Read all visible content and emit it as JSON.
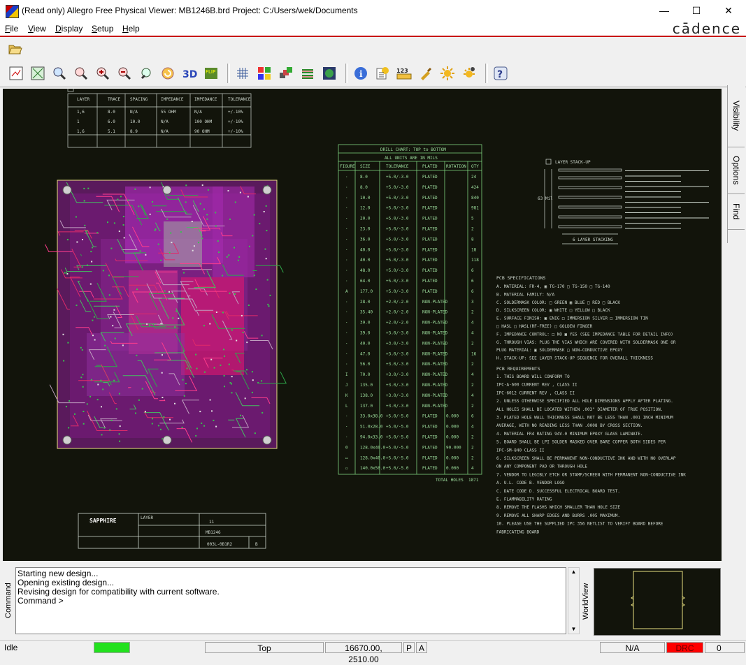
{
  "window": {
    "title": "(Read only) Allegro Free Physical Viewer: MB1246B.brd  Project: C:/Users/wek/Documents",
    "minimize": "—",
    "maximize": "☐",
    "close": "✕"
  },
  "brand": "cādence",
  "menu": [
    {
      "label": "File",
      "key": "F",
      "rest": "ile"
    },
    {
      "label": "View",
      "key": "V",
      "rest": "iew"
    },
    {
      "label": "Display",
      "key": "D",
      "rest": "isplay"
    },
    {
      "label": "Setup",
      "key": "S",
      "rest": "etup"
    },
    {
      "label": "Help",
      "key": "H",
      "rest": "elp"
    }
  ],
  "toolbar_icons": [
    "open-icon",
    "zoom-fit-icon",
    "zoom-world-icon",
    "zoom-window-icon",
    "zoom-previous-icon",
    "zoom-in-icon",
    "zoom-out-icon",
    "redraw-icon",
    "refresh-icon",
    "3d-view-icon",
    "flip-icon",
    "grid-icon",
    "color-icon",
    "layers-icon",
    "stack-icon",
    "world-icon",
    "info-icon",
    "properties-icon",
    "measure-icon",
    "highlight-icon",
    "brightness-icon",
    "dim-icon",
    "help-icon"
  ],
  "right_tabs": [
    "Visibility",
    "Options",
    "Find"
  ],
  "command": {
    "label": "Command",
    "lines": [
      "Starting new design...",
      "Opening existing design...",
      "Revising design for compatibility with current software.",
      "Command >"
    ]
  },
  "worldview_label": "WorldView",
  "status": {
    "state": "Idle",
    "layer": "Top",
    "coords": "16670.00, 2510.00",
    "p_btn": "P",
    "a_btn": "A",
    "na": "N/A",
    "drc": "DRC",
    "count": "0"
  },
  "colors": {
    "accent_red": "#c81414",
    "canvas_bg": "#12140b",
    "drawing_green": "#7fd47f",
    "board_purple": "#6b1a6f",
    "status_green": "#22e11e",
    "drc_red": "#ff0000"
  },
  "drawing": {
    "drill_chart_title": "DRILL CHART: TOP to BOTTOM",
    "drill_chart_units": "ALL UNITS ARE IN MILS",
    "drill_headers": [
      "FIGURE",
      "SIZE",
      "TOLERANCE",
      "PLATED",
      "ROTATION",
      "QTY"
    ],
    "drill_rows": [
      [
        "·",
        "8.0",
        "+5.0/-3.0",
        "PLATED",
        "",
        "24"
      ],
      [
        "·",
        "8.0",
        "+5.0/-3.0",
        "PLATED",
        "",
        "424"
      ],
      [
        "·",
        "10.0",
        "+5.0/-3.0",
        "PLATED",
        "",
        "840"
      ],
      [
        "·",
        "12.0",
        "+5.0/-3.0",
        "PLATED",
        "",
        "981"
      ],
      [
        "·",
        "20.0",
        "+5.0/-3.0",
        "PLATED",
        "",
        "5"
      ],
      [
        "·",
        "23.0",
        "+5.0/-3.0",
        "PLATED",
        "",
        "2"
      ],
      [
        "·",
        "36.0",
        "+5.0/-3.0",
        "PLATED",
        "",
        "8"
      ],
      [
        "·",
        "40.0",
        "+5.0/-3.0",
        "PLATED",
        "",
        "18"
      ],
      [
        "·",
        "40.0",
        "+5.0/-3.0",
        "PLATED",
        "",
        "118"
      ],
      [
        "·",
        "48.0",
        "+5.0/-3.0",
        "PLATED",
        "",
        "6"
      ],
      [
        "·",
        "64.0",
        "+5.0/-3.0",
        "PLATED",
        "",
        "6"
      ],
      [
        "A",
        "177.0",
        "+5.0/-3.0",
        "PLATED",
        "",
        "6"
      ],
      [
        "·",
        "28.0",
        "+2.0/-2.0",
        "NON-PLATED",
        "",
        "3"
      ],
      [
        "·",
        "35.40",
        "+2.0/-2.0",
        "NON-PLATED",
        "",
        "2"
      ],
      [
        "·",
        "39.0",
        "+2.0/-2.0",
        "NON-PLATED",
        "",
        "4"
      ],
      [
        "·",
        "39.0",
        "+3.0/-3.0",
        "NON-PLATED",
        "",
        "4"
      ],
      [
        "·",
        "40.0",
        "+3.0/-3.0",
        "NON-PLATED",
        "",
        "2"
      ],
      [
        "·",
        "47.0",
        "+3.0/-3.0",
        "NON-PLATED",
        "",
        "16"
      ],
      [
        "·",
        "56.0",
        "+3.0/-3.0",
        "NON-PLATED",
        "",
        "2"
      ],
      [
        "I",
        "70.0",
        "+3.0/-3.0",
        "NON-PLATED",
        "",
        "4"
      ],
      [
        "J",
        "135.0",
        "+3.0/-3.0",
        "NON-PLATED",
        "",
        "2"
      ],
      [
        "K",
        "138.0",
        "+3.0/-3.0",
        "NON-PLATED",
        "",
        "4"
      ],
      [
        "L",
        "137.0",
        "+3.0/-3.0",
        "NON-PLATED",
        "",
        "2"
      ],
      [
        "·",
        "33.0x38.0",
        "+5.0/-5.0",
        "PLATED",
        "0.000",
        "6"
      ],
      [
        "·",
        "51.0x28.0",
        "+5.0/-5.0",
        "PLATED",
        "0.000",
        "4"
      ],
      [
        "·",
        "94.0x33.0",
        "+5.0/-5.0",
        "PLATED",
        "0.000",
        "2"
      ],
      [
        "0",
        "128.0x40.0",
        "+5.0/-5.0",
        "PLATED",
        "90.000",
        "2"
      ],
      [
        "▭",
        "128.0x40.0",
        "+5.0/-5.0",
        "PLATED",
        "0.000",
        "2"
      ],
      [
        "▭",
        "140.0x50.0",
        "+5.0/-5.0",
        "PLATED",
        "0.000",
        "4"
      ]
    ],
    "total_holes_label": "TOTAL HOLES",
    "total_holes": "1871",
    "imp_headers": [
      "LAYER",
      "TRACE",
      "SPACING",
      "IMPEDANCE",
      "IMPEDANCE",
      "TOLERANCE"
    ],
    "imp_rows": [
      [
        "1,6",
        "8.0",
        "N/A",
        "55 OHM",
        "N/A",
        "+/-10%"
      ],
      [
        "1",
        "6.0",
        "10.0",
        "N/A",
        "100 OHM",
        "+/-10%"
      ],
      [
        "1,6",
        "5.1",
        "8.9",
        "N/A",
        "90 OHM",
        "+/-10%"
      ]
    ],
    "stackup_title": "LAYER STACK-UP",
    "stackup_caption": "6 LAYER STACKING",
    "stackup_dim": "63 Mil",
    "pcb_spec_title": "PCB SPECIFICATIONS",
    "pcb_spec_lines": [
      "A. MATERIAL:          FR-4,     ▣ TG-170  □ TG-150  □ TG-140",
      "B. MATERIAL FAMILY:   N/A",
      "C. SOLDERMASK COLOR:  □ GREEN  ▣ BLUE  □ RED  □ BLACK",
      "D. SILKSCREEN COLOR:  ▣ WHITE  □ YELLOW  □ BLACK",
      "E. SURFACE FINISH:    ▣ ENIG  □ IMMERSION SILVER  □ IMMERSION TIN",
      "                      □ HASL  □ HASL(RF-FREE)  □ GOLDEN FINGER",
      "F. IMPEDANCE CONTROL: □ NO  ▣ YES  (SEE IMPEDANCE TABLE FOR DETAIL INFO)",
      "G. THROUGH VIAS:      PLUG THE VIAS WHICH ARE COVERED WITH SOLDERMASK ONE OR",
      "                      PLUG MATERIAL: ▣ SOLDERMASK  □ NON-CONDUCTIVE EPOXY",
      "H. STACK-UP:          SEE LAYER STACK-UP SEQUENCE FOR OVERALL THICKNESS"
    ],
    "pcb_req_title": "PCB REQUIREMENTS",
    "pcb_req_lines": [
      "1. THIS BOARD WILL CONFORM TO",
      "   IPC-A-600  CURRENT REV , CLASS II",
      "   IPC-6012  CURRENT REV , CLASS II",
      "2. UNLESS OTHERWISE SPECIFIED ALL HOLE DIMENSIONS APPLY AFTER PLATING.",
      "   ALL HOLES SHALL BE LOCATED WITHIN .003\" DIAMETER OF TRUE POSITION.",
      "3. PLATED HOLE WALL THICKNESS SHALL NOT BE LESS THAN .001 INCH MINIMUM",
      "   AVERAGE, WITH NO READING LESS THAN .0008 BY CROSS SECTION.",
      "4. MATERIAL FR4 RATING 94V-0 MINIMUM EPOXY GLASS LAMINATE.",
      "5. BOARD SHALL BE LPI SOLDER MASKED OVER BARE COPPER BOTH SIDES PER",
      "   IPC-SM-840 CLASS II",
      "6. SILKSCREEN SHALL BE PERMANENT NON-CONDUCTIVE INK AND WITH NO OVERLAP",
      "   ON ANY COMPONENT PAD OR THROUGH HOLE",
      "7. VENDOR TO LEGIBLY ETCH OR STAMP/SCREEN WITH PERMANENT NON-CONDUCTIVE INK",
      "   A. U.L. CODE          B. VENDOR LOGO",
      "   C. DATE CODE          D. SUCCESSFUL ELECTRICAL BOARD TEST.",
      "   E. FLAMMABILITY RATING",
      "8. REMOVE THE FLASHS WHICH SMALLER THAN HOLE SIZE",
      "9. REMOVE ALL SHARP EDGES AND BURRS .005 MAXIMUM.",
      "10. PLEASE USE THE SUPPLIED IPC 356 NETLIST TO VERIFY BOARD BEFORE",
      "    FABRICATING BOARD"
    ],
    "title_block_logo": "SAPPHIRE",
    "title_block_layer": "LAYER",
    "title_block_count": "11",
    "title_block_part": "MB1246",
    "title_block_number": "003L-0B1R2",
    "title_block_rev": "B"
  }
}
